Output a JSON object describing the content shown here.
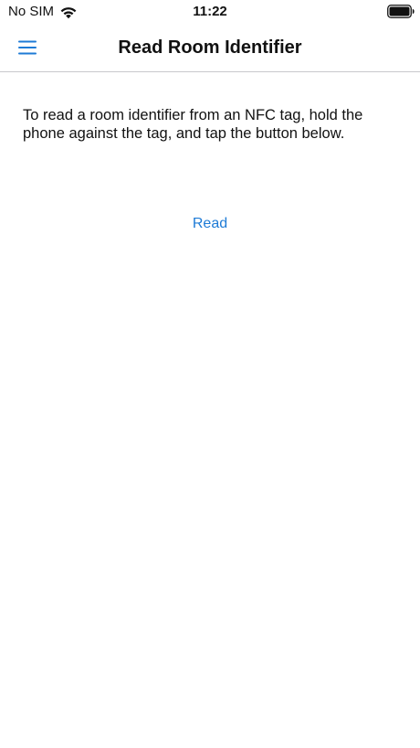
{
  "status_bar": {
    "carrier": "No SIM",
    "time": "11:22",
    "wifi_icon": "wifi-icon",
    "battery_icon": "battery-icon"
  },
  "nav_bar": {
    "menu_icon": "hamburger-menu-icon",
    "title": "Read Room Identifier"
  },
  "content": {
    "instructions": "To read a room identifier from an NFC tag, hold the phone against the tag, and tap the button below.",
    "read_button_label": "Read"
  },
  "colors": {
    "accent": "#1e7bd6",
    "divider": "#c8c8cc",
    "text": "#111111",
    "background": "#ffffff"
  }
}
